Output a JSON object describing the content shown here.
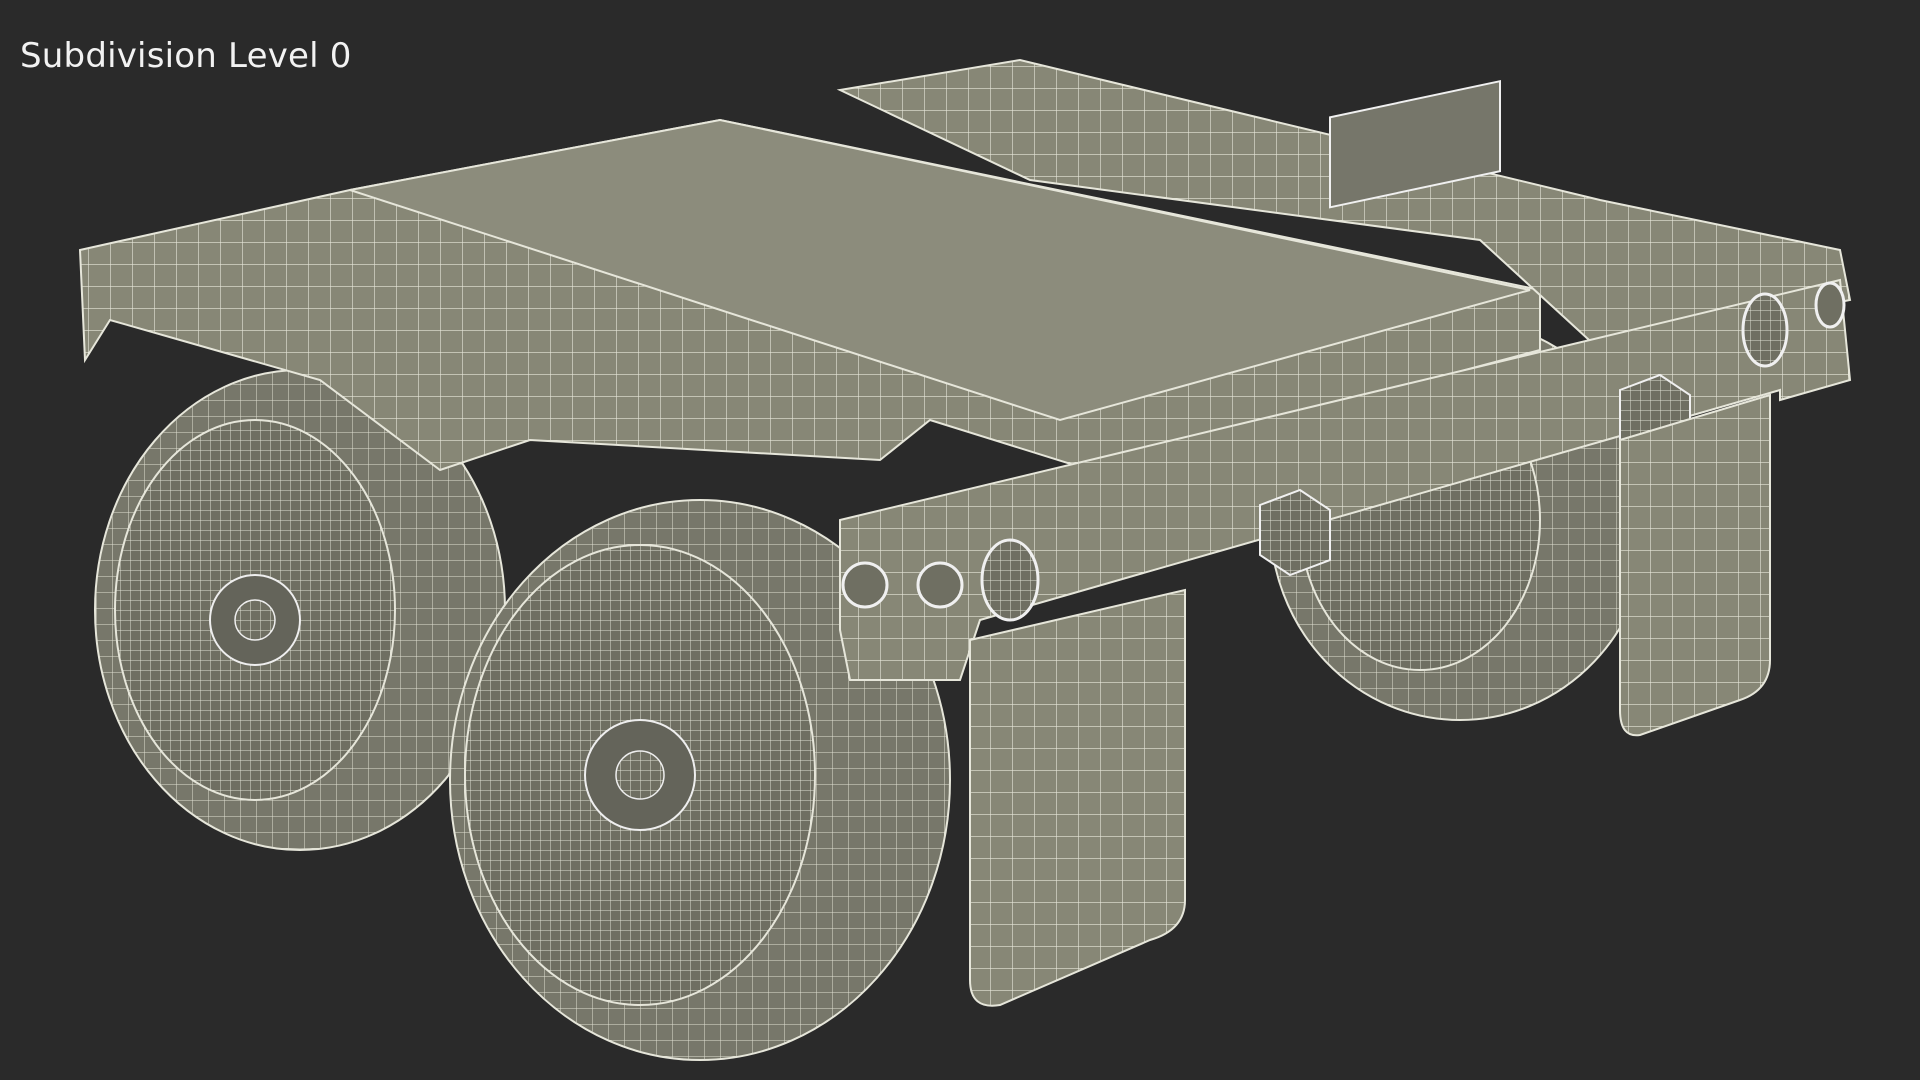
{
  "viewport": {
    "overlay_label": "Subdivision Level 0",
    "background_color": "#2a2a2a",
    "model_fill_color": "#8a8a7a",
    "wire_color": "#e6e6da"
  }
}
